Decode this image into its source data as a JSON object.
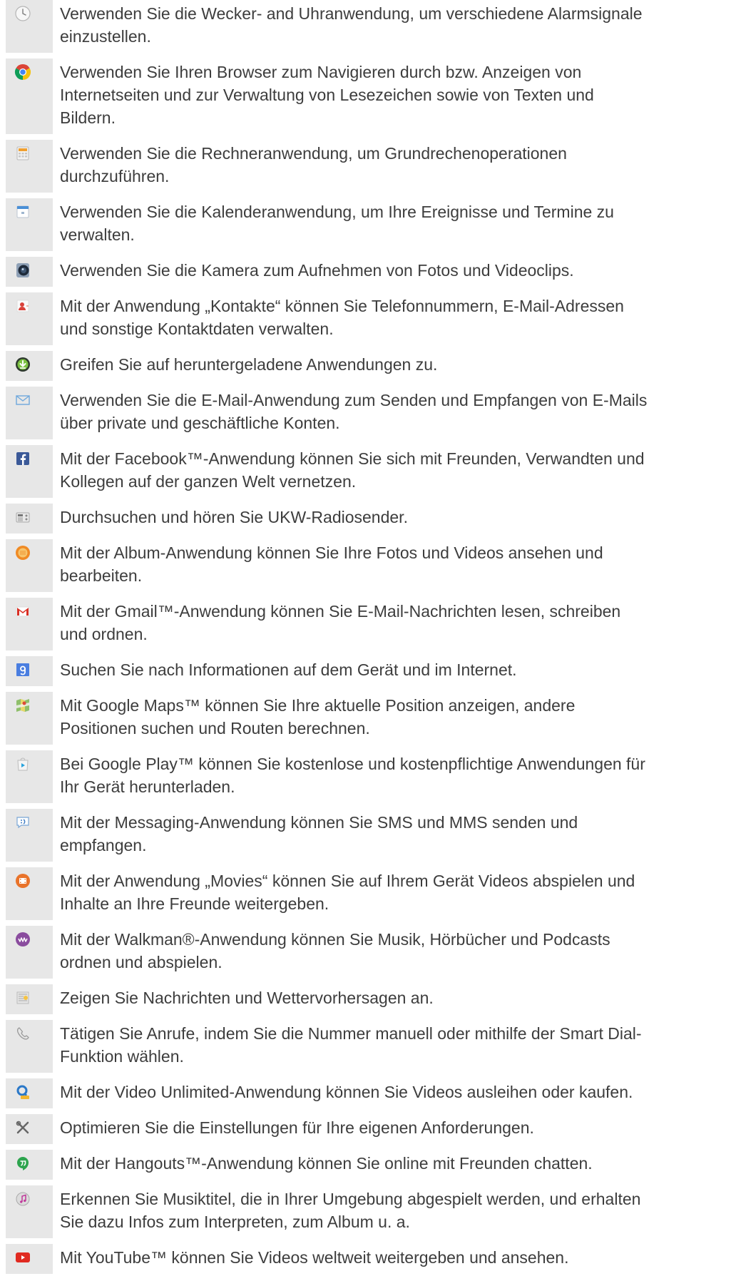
{
  "colors": {
    "page_background": "#ffffff",
    "icon_cell_background": "#e7e7e7",
    "text": "#3d3d3d"
  },
  "items": [
    {
      "icon": "clock-icon",
      "text": "Verwenden Sie die Wecker- and Uhranwendung, um verschiedene Alarmsignale\neinzustellen."
    },
    {
      "icon": "browser-icon",
      "text": "Verwenden Sie Ihren Browser zum Navigieren durch bzw. Anzeigen von\nInternetseiten und zur Verwaltung von Lesezeichen sowie von Texten und\nBildern."
    },
    {
      "icon": "calculator-icon",
      "text": "Verwenden Sie die Rechneranwendung, um Grundrechenoperationen\ndurchzuführen."
    },
    {
      "icon": "calendar-icon",
      "text": "Verwenden Sie die Kalenderanwendung, um Ihre Ereignisse und Termine zu\nverwalten."
    },
    {
      "icon": "camera-icon",
      "text": "Verwenden Sie die Kamera zum Aufnehmen von Fotos und Videoclips."
    },
    {
      "icon": "contacts-icon",
      "text": "Mit der Anwendung „Kontakte“ können Sie Telefonnummern, E-Mail-Adressen\nund sonstige Kontaktdaten verwalten."
    },
    {
      "icon": "download-icon",
      "text": "Greifen Sie auf heruntergeladene Anwendungen zu."
    },
    {
      "icon": "email-icon",
      "text": "Verwenden Sie die E-Mail-Anwendung zum Senden und Empfangen von E-Mails\nüber private und geschäftliche Konten."
    },
    {
      "icon": "facebook-icon",
      "text": "Mit der Facebook™-Anwendung können Sie sich mit Freunden, Verwandten und\nKollegen auf der ganzen Welt vernetzen."
    },
    {
      "icon": "fm-radio-icon",
      "text": "Durchsuchen und hören Sie UKW-Radiosender."
    },
    {
      "icon": "album-icon",
      "text": "Mit der Album-Anwendung können Sie Ihre Fotos und Videos ansehen und\nbearbeiten."
    },
    {
      "icon": "gmail-icon",
      "text": "Mit der Gmail™-Anwendung können Sie E-Mail-Nachrichten lesen, schreiben\nund ordnen."
    },
    {
      "icon": "google-search-icon",
      "text": "Suchen Sie nach Informationen auf dem Gerät und im Internet."
    },
    {
      "icon": "maps-icon",
      "text": "Mit Google Maps™ können Sie Ihre aktuelle Position anzeigen, andere\nPositionen suchen und Routen berechnen."
    },
    {
      "icon": "play-store-icon",
      "text": "Bei Google Play™ können Sie kostenlose und kostenpflichtige Anwendungen für\nIhr Gerät herunterladen."
    },
    {
      "icon": "messaging-icon",
      "text": "Mit der Messaging-Anwendung können Sie SMS und MMS senden und\nempfangen."
    },
    {
      "icon": "movies-icon",
      "text": "Mit der Anwendung „Movies“ können Sie auf Ihrem Gerät Videos abspielen und\nInhalte an Ihre Freunde weitergeben."
    },
    {
      "icon": "walkman-icon",
      "text": "Mit der Walkman®-Anwendung können Sie Musik, Hörbücher und Podcasts\nordnen und abspielen."
    },
    {
      "icon": "news-weather-icon",
      "text": "Zeigen Sie Nachrichten und Wettervorhersagen an."
    },
    {
      "icon": "phone-icon",
      "text": "Tätigen Sie Anrufe, indem Sie die Nummer manuell oder mithilfe der Smart Dial-\nFunktion wählen."
    },
    {
      "icon": "video-unlimited-icon",
      "text": "Mit der Video Unlimited-Anwendung können Sie Videos ausleihen oder kaufen."
    },
    {
      "icon": "settings-icon",
      "text": "Optimieren Sie die Einstellungen für Ihre eigenen Anforderungen."
    },
    {
      "icon": "hangouts-icon",
      "text": "Mit der Hangouts™-Anwendung können Sie online mit Freunden chatten."
    },
    {
      "icon": "trackid-icon",
      "text": "Erkennen Sie Musiktitel, die in Ihrer Umgebung abgespielt werden, und erhalten\nSie dazu Infos zum Interpreten, zum Album u. a."
    },
    {
      "icon": "youtube-icon",
      "text": "Mit YouTube™ können Sie Videos weltweit weitergeben und ansehen."
    }
  ]
}
